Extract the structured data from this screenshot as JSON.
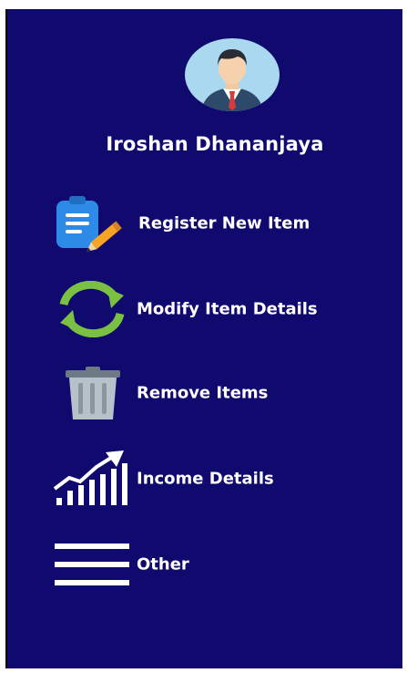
{
  "user": {
    "name": "Iroshan Dhananjaya",
    "avatar_icon": "user-avatar-icon"
  },
  "menu": {
    "items": [
      {
        "label": "Register New Item",
        "icon": "clipboard-pencil-icon"
      },
      {
        "label": "Modify Item Details",
        "icon": "refresh-cycle-icon"
      },
      {
        "label": "Remove Items",
        "icon": "trash-bin-icon"
      },
      {
        "label": "Income Details",
        "icon": "growth-chart-icon"
      },
      {
        "label": "Other",
        "icon": "hamburger-menu-icon"
      }
    ]
  },
  "colors": {
    "sidebar_bg": "#10096e",
    "text": "#ffffff",
    "avatar_bg": "#a9d8ef",
    "clipboard_blue": "#2d8ae6",
    "pencil_orange": "#f7a323",
    "cycle_green": "#7ac143",
    "trash_gray": "#9aa6b0"
  }
}
